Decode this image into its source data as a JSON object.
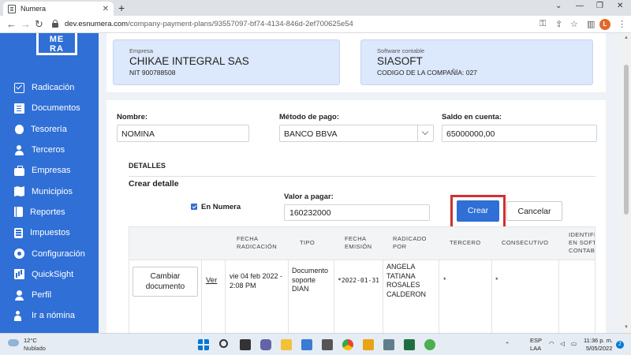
{
  "browser": {
    "tab_title": "Numera",
    "url_host": "dev.esnumera.com",
    "url_path": "/company-payment-plans/93557097-bf74-4134-846d-2ef700625e54",
    "profile_initial": "L"
  },
  "sidebar": {
    "logo": "ME\nRA",
    "items": [
      {
        "label": "Radicación",
        "icon": "check-square-icon"
      },
      {
        "label": "Documentos",
        "icon": "document-icon"
      },
      {
        "label": "Tesorería",
        "icon": "money-bag-icon"
      },
      {
        "label": "Terceros",
        "icon": "users-icon"
      },
      {
        "label": "Empresas",
        "icon": "briefcase-icon"
      },
      {
        "label": "Municipios",
        "icon": "map-icon"
      },
      {
        "label": "Reportes",
        "icon": "book-icon"
      },
      {
        "label": "Impuestos",
        "icon": "calculator-icon"
      },
      {
        "label": "Configuración",
        "icon": "gear-icon"
      },
      {
        "label": "QuickSight",
        "icon": "chart-icon"
      },
      {
        "label": "Perfil",
        "icon": "person-icon"
      },
      {
        "label": "Ir a nómina",
        "icon": "person-exit-icon"
      }
    ],
    "accent": "#2f6fd6"
  },
  "empresa": {
    "label": "Empresa",
    "name": "CHIKAE INTEGRAL SAS",
    "nit": "NIT 900788508"
  },
  "software": {
    "label": "Software contable",
    "name": "SIASOFT",
    "code": "CODIGO DE LA COMPAÑÍA: 027"
  },
  "form": {
    "nombre_label": "Nombre:",
    "nombre_value": "NOMINA",
    "metodo_label": "Método de pago:",
    "metodo_value": "BANCO BBVA",
    "saldo_label": "Saldo en cuenta:",
    "saldo_value": "65000000,00"
  },
  "detalles": {
    "section_title": "DETALLES",
    "subtitle": "Crear detalle",
    "checkbox_label": "En Numera",
    "checkbox_checked": true,
    "valor_label": "Valor a pagar:",
    "valor_value": "160232000",
    "crear_label": "Crear",
    "cancelar_label": "Cancelar"
  },
  "table": {
    "headers": [
      "FECHA\nRADICACIÓN",
      "TIPO",
      "FECHA\nEMISIÓN",
      "RADICADO\nPOR",
      "TERCERO",
      "CONSECUTIVO",
      "IDENTIFI\nEN SOFT\nCONTABL"
    ],
    "row": {
      "action_label": "Cambiar documento",
      "link_label": "Ver",
      "fecha_radicacion": "vie 04 feb 2022 - 2:08 PM",
      "tipo": "Documento soporte DIAN",
      "fecha_emision": "*2022-01-31",
      "radicado_por": "ANGELA TATIANA ROSALES CALDERON",
      "tercero": "*",
      "consecutivo": "*"
    }
  },
  "taskbar": {
    "temp": "12°C",
    "weather": "Nublado",
    "lang1": "ESP",
    "lang2": "LAA",
    "time": "11:36 p. m.",
    "date": "5/05/2022",
    "notifications": "2"
  }
}
